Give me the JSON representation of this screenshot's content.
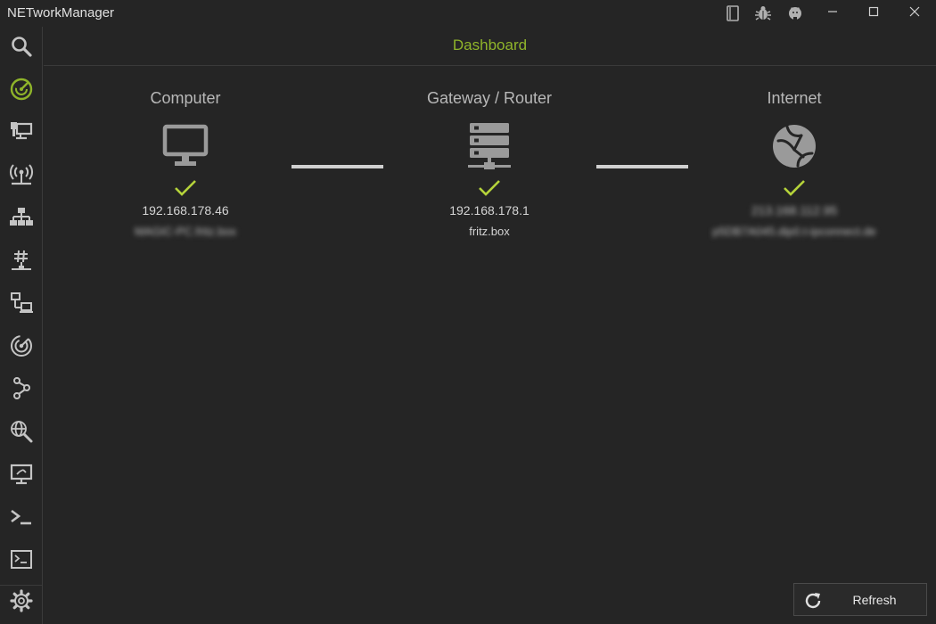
{
  "window": {
    "title": "NETworkManager",
    "toolbar_icons": [
      "book-icon",
      "bug-icon",
      "github-icon"
    ],
    "controls": [
      "minimize-icon",
      "maximize-icon",
      "close-icon"
    ]
  },
  "sidebar": {
    "items": [
      {
        "name": "search",
        "icon": "search-icon"
      },
      {
        "name": "dashboard",
        "icon": "speedometer-icon",
        "active": true
      },
      {
        "name": "network-interface",
        "icon": "network-interface-icon"
      },
      {
        "name": "wifi",
        "icon": "wifi-antenna-icon"
      },
      {
        "name": "ip-scanner",
        "icon": "sitemap-icon"
      },
      {
        "name": "port-scanner",
        "icon": "hash-network-icon"
      },
      {
        "name": "remote-desktop",
        "icon": "lan-connect-icon"
      },
      {
        "name": "radar",
        "icon": "radar-icon"
      },
      {
        "name": "traceroute",
        "icon": "graph-icon"
      },
      {
        "name": "dns-lookup",
        "icon": "web-search-icon"
      },
      {
        "name": "remote-screen",
        "icon": "monitor-remote-icon"
      },
      {
        "name": "powershell",
        "icon": "console-prompt-icon"
      },
      {
        "name": "terminal",
        "icon": "terminal-icon"
      }
    ],
    "settings_icon": "gear-icon"
  },
  "header": {
    "title": "Dashboard"
  },
  "colors": {
    "accent": "#8fb42a",
    "check": "#b5d33a",
    "icon": "#9a9a9a",
    "background": "#252525"
  },
  "nodes": {
    "computer": {
      "title": "Computer",
      "icon": "monitor-icon",
      "status": "check-icon",
      "ip": "192.168.178.46",
      "host": "MAGIC-PC.fritz.box"
    },
    "gateway": {
      "title": "Gateway / Router",
      "icon": "server-network-icon",
      "status": "check-icon",
      "ip": "192.168.178.1",
      "host": "fritz.box"
    },
    "internet": {
      "title": "Internet",
      "icon": "globe-icon",
      "status": "check-icon",
      "ip": "213.168.112.95",
      "host": "p5DB7A045.dip0.t-ipconnect.de"
    }
  },
  "actions": {
    "refresh_label": "Refresh"
  }
}
